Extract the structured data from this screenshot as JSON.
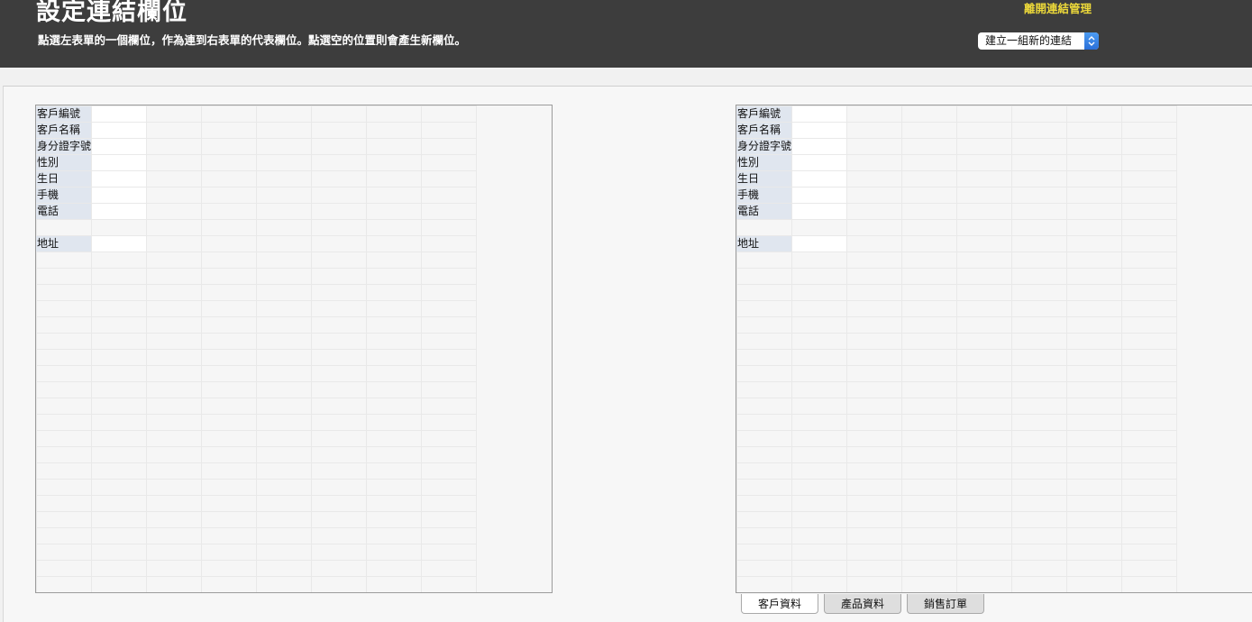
{
  "header": {
    "title": "設定連結欄位",
    "subtitle": "點選左表單的一個欄位，作為連到右表單的代表欄位。點選空的位置則會產生新欄位。",
    "leave_link": "離開連結管理",
    "link_select": {
      "selected": "建立一組新的連結"
    }
  },
  "left_form": {
    "fields": [
      {
        "label": "客戶編號"
      },
      {
        "label": "客戶名稱"
      },
      {
        "label": "身分證字號"
      },
      {
        "label": "性別"
      },
      {
        "label": "生日"
      },
      {
        "label": "手機"
      },
      {
        "label": "電話"
      },
      {
        "label": "地址"
      }
    ]
  },
  "right_form": {
    "fields": [
      {
        "label": "客戶編號"
      },
      {
        "label": "客戶名稱"
      },
      {
        "label": "身分證字號"
      },
      {
        "label": "性別"
      },
      {
        "label": "生日"
      },
      {
        "label": "手機"
      },
      {
        "label": "電話"
      },
      {
        "label": "地址"
      }
    ],
    "tabs": [
      {
        "label": "客戶資料",
        "active": true
      },
      {
        "label": "產品資料",
        "active": false
      },
      {
        "label": "銷售訂單",
        "active": false
      }
    ]
  }
}
